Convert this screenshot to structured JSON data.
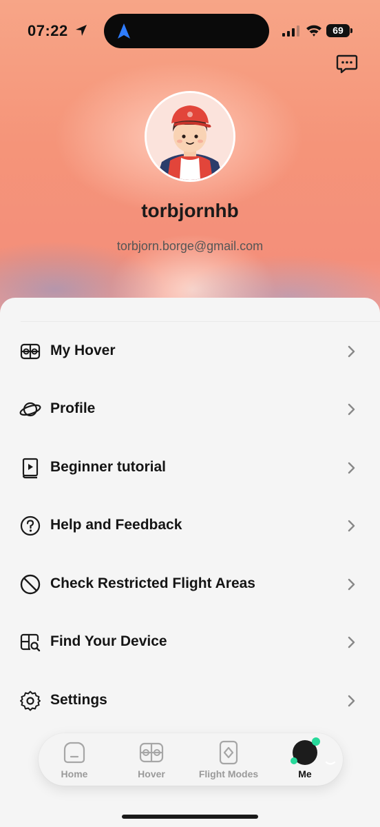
{
  "status_bar": {
    "time": "07:22",
    "battery": "69"
  },
  "profile": {
    "username": "torbjornhb",
    "email": "torbjorn.borge@gmail.com"
  },
  "menu": {
    "items": [
      {
        "label": "My Hover",
        "icon": "hover-icon"
      },
      {
        "label": "Profile",
        "icon": "planet-icon"
      },
      {
        "label": "Beginner tutorial",
        "icon": "tutorial-book-icon"
      },
      {
        "label": "Help and Feedback",
        "icon": "question-circle-icon"
      },
      {
        "label": "Check Restricted Flight Areas",
        "icon": "no-entry-icon"
      },
      {
        "label": "Find Your Device",
        "icon": "find-device-icon"
      },
      {
        "label": "Settings",
        "icon": "gear-icon"
      }
    ]
  },
  "tabbar": {
    "tabs": [
      {
        "label": "Home",
        "icon": "home-icon"
      },
      {
        "label": "Hover",
        "icon": "hover-icon"
      },
      {
        "label": "Flight Modes",
        "icon": "flight-modes-icon"
      },
      {
        "label": "Me",
        "icon": "me-avatar-icon"
      }
    ],
    "active": "Me"
  },
  "colors": {
    "accent_green": "#27d99a",
    "hero_orange": "#f59479"
  }
}
